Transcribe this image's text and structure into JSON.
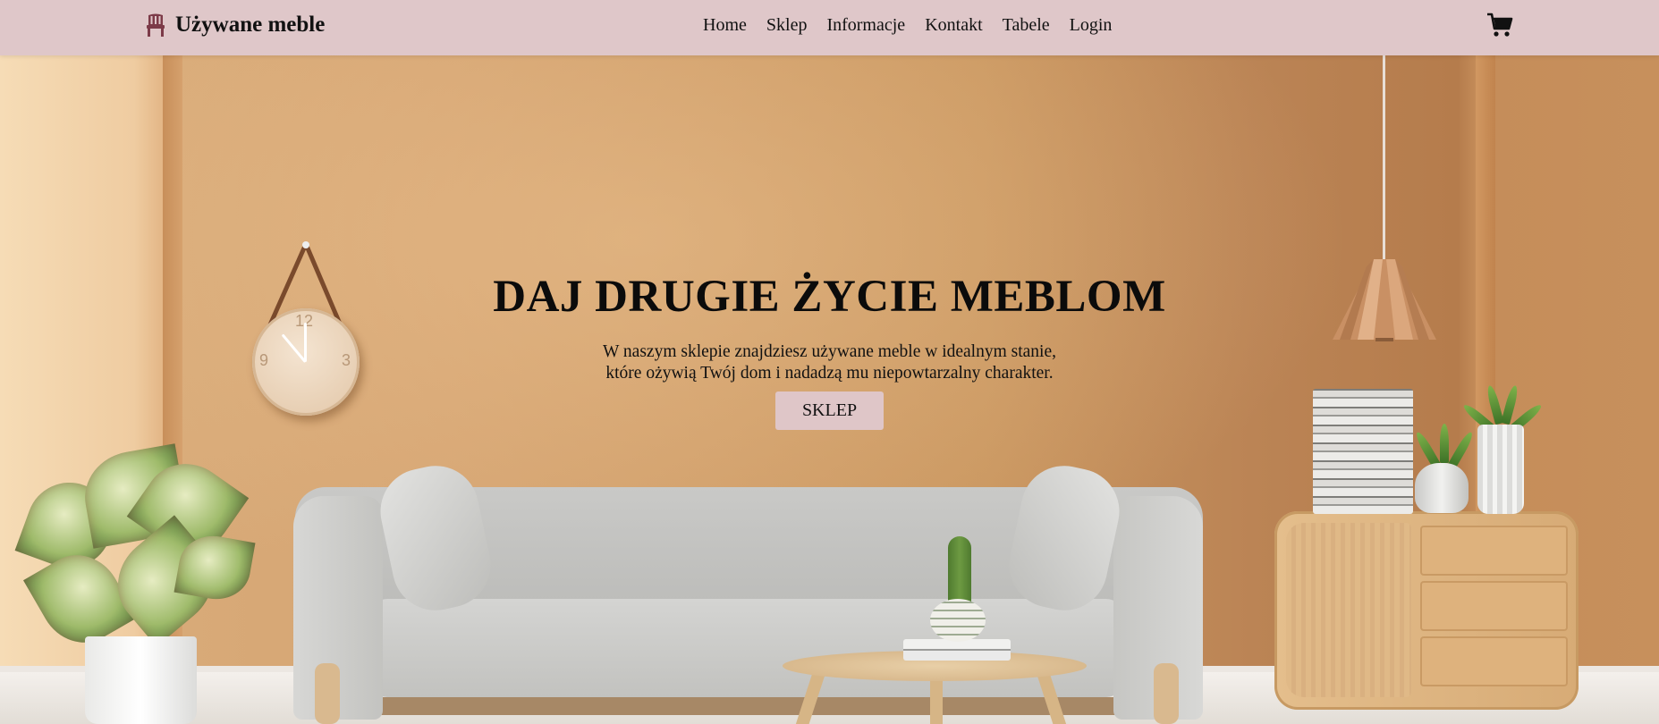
{
  "navbar": {
    "brand_icon": "chair-icon",
    "brand_name": "Używane meble",
    "links": [
      "Home",
      "Sklep",
      "Informacje",
      "Kontakt",
      "Tabele",
      "Login"
    ],
    "cart_icon": "shopping-cart-icon",
    "background_color": "#dfc7c9"
  },
  "hero": {
    "title": "DAJ DRUGIE ŻYCIE MEBLOM",
    "subtitle_line1": "W naszym sklepie znajdziesz używane meble w idealnym stanie,",
    "subtitle_line2": "które ożywią Twój dom i nadadzą mu niepowtarzalny charakter.",
    "button_label": "SKLEP",
    "button_color": "#dfc6c8"
  },
  "background_image": {
    "clock_numbers": [
      "12",
      "3",
      "9"
    ]
  }
}
